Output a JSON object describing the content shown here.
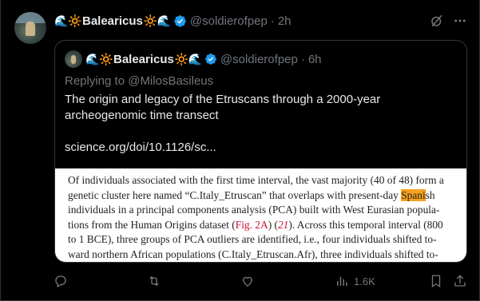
{
  "tweet": {
    "display_name": "Balearicus",
    "handle": "@soldierofpep",
    "separator": "·",
    "time": "2h",
    "avatar_icon": "profile-photo"
  },
  "quote": {
    "display_name": "Balearicus",
    "handle": "@soldierofpep",
    "separator": "·",
    "time": "6h",
    "replying_to": "Replying to @MilosBasileus",
    "text": "The origin and legacy of the Etruscans through a 2000-year archeogenomic time transect",
    "link": "science.org/doi/10.1126/sc..."
  },
  "paper": {
    "line1": "Of individuals associated with the first time interval, the vast majority (40 of 48) form a",
    "line2_pre": "genetic cluster here named “C.Italy_Etruscan” that overlaps with present-day ",
    "line2_hl": "Spani",
    "line2_post": "sh",
    "line3": "individuals in a principal components analysis (PCA) built with West Eurasian popula-",
    "line4_pre": "tions from the Human Origins dataset (",
    "line4_fig": "Fig. 2A",
    "line4_mid": ") (",
    "line4_ref": "21",
    "line4_post": "). Across this temporal interval (800",
    "line5": "to 1 BCE), three groups of PCA outliers are identified, i.e., four individuals shifted to-",
    "line6": "ward northern African populations (C.Italy_Etruscan.Afr), three individuals shifted to-"
  },
  "actions": {
    "reply_count": "",
    "retweet_count": "",
    "like_count": "",
    "views_count": "1.6K"
  },
  "colors": {
    "wave": "#3b9ae8",
    "sun": "#f5b21f",
    "verified": "#1d9bf0",
    "muted": "#71767b",
    "highlight": "#f7a11c"
  },
  "icons": [
    "wave-emoji-icon",
    "sun-emoji-icon",
    "verified-badge-icon",
    "grok-icon",
    "more-icon",
    "reply-icon",
    "retweet-icon",
    "like-icon",
    "views-icon",
    "bookmark-icon",
    "share-icon"
  ]
}
